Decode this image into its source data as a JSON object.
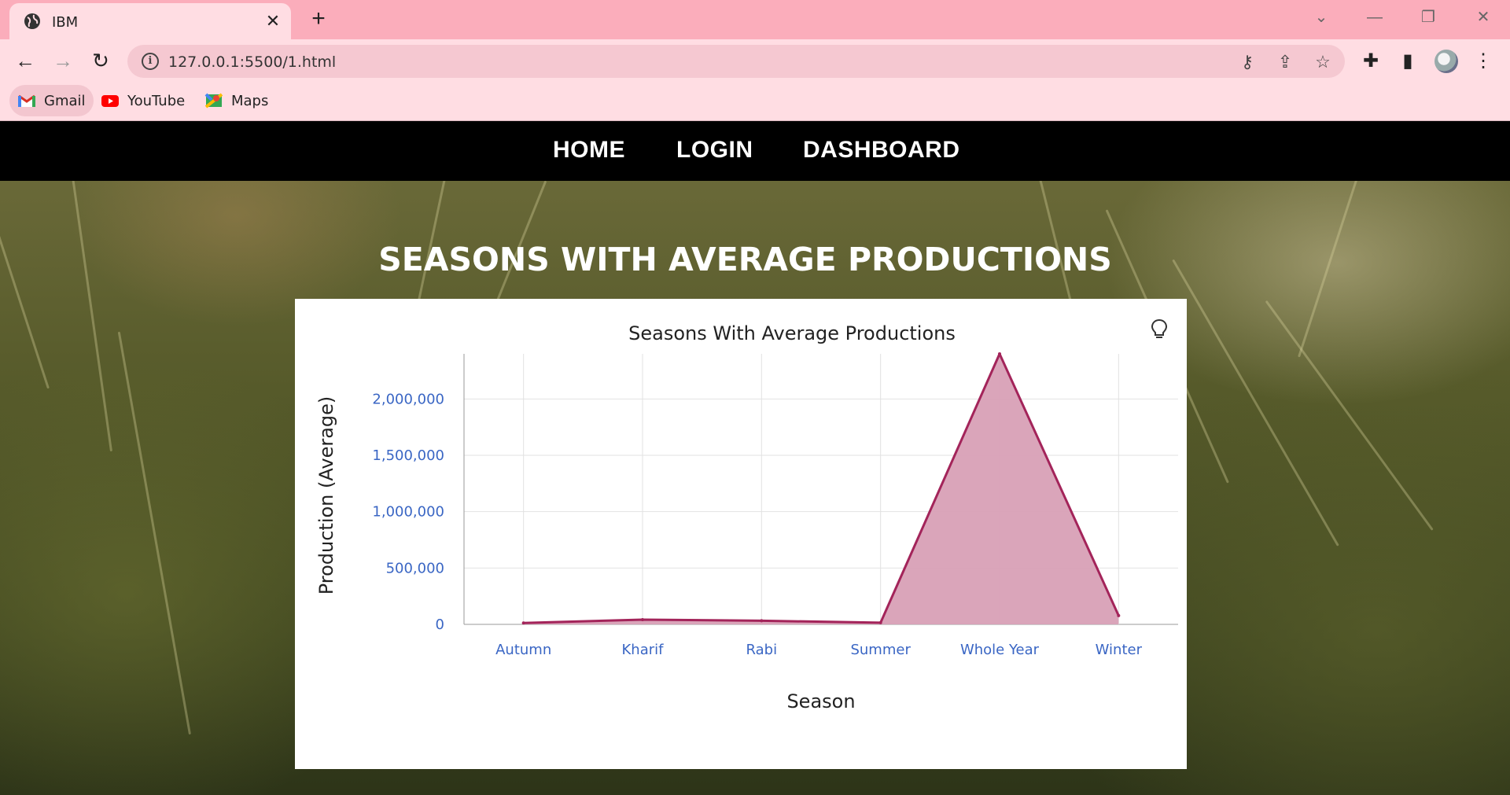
{
  "browser": {
    "tab_title": "IBM",
    "url": "127.0.0.1:5500/1.html",
    "bookmarks": [
      {
        "label": "Gmail",
        "icon": "gmail-icon"
      },
      {
        "label": "YouTube",
        "icon": "youtube-icon"
      },
      {
        "label": "Maps",
        "icon": "maps-icon"
      }
    ]
  },
  "nav": {
    "items": [
      {
        "label": "HOME"
      },
      {
        "label": "LOGIN"
      },
      {
        "label": "DASHBOARD"
      }
    ]
  },
  "page": {
    "heading": "SEASONS WITH AVERAGE PRODUCTIONS"
  },
  "chart_data": {
    "type": "area",
    "title": "Seasons With Average Productions",
    "xlabel": "Season",
    "ylabel": "Production (Average)",
    "categories": [
      "Autumn",
      "Kharif",
      "Rabi",
      "Summer",
      "Whole Year",
      "Winter"
    ],
    "values": [
      12000,
      42000,
      32000,
      15000,
      2400000,
      78000
    ],
    "ylim": [
      0,
      2400000
    ],
    "yticks": [
      0,
      500000,
      1000000,
      1500000,
      2000000
    ],
    "ytick_labels": [
      "0",
      "500,000",
      "1,000,000",
      "1,500,000",
      "2,000,000"
    ],
    "grid": true,
    "colors": {
      "line": "#a3245a",
      "fill": "#d8a0b6",
      "tick": "#3a66c4"
    }
  }
}
